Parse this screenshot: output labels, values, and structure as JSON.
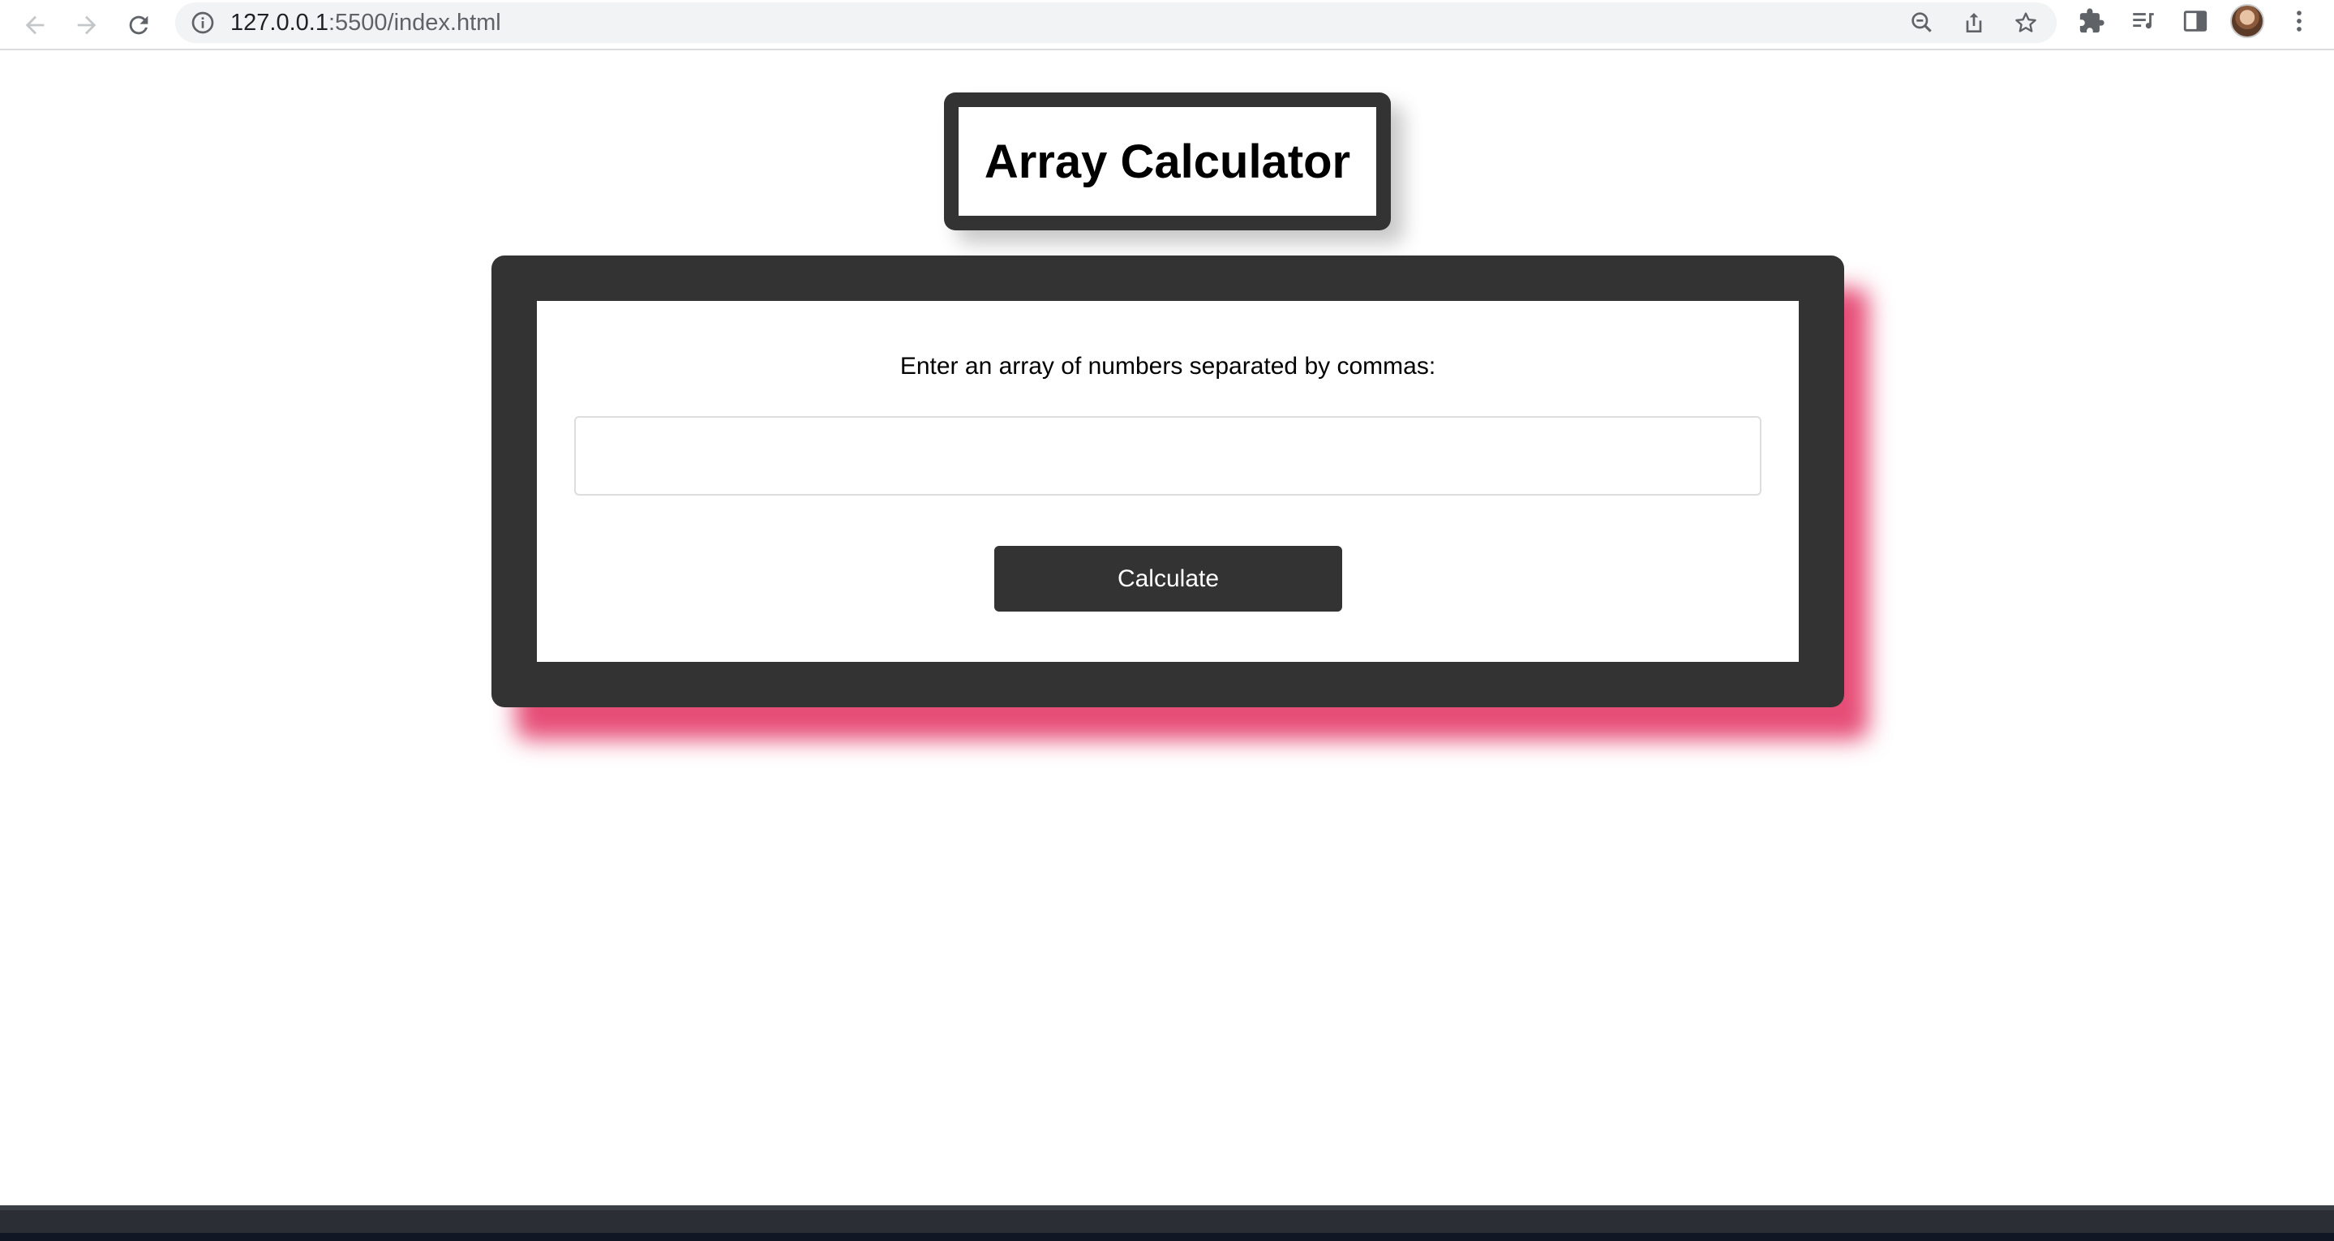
{
  "browser": {
    "url_host": "127.0.0.1",
    "url_rest": ":5500/index.html",
    "icons": {
      "back": "arrow-left-icon",
      "forward": "arrow-right-icon",
      "reload": "reload-icon",
      "site_info": "info-icon",
      "zoom": "zoom-out-icon",
      "share": "share-icon",
      "bookmark": "star-icon",
      "extensions": "puzzle-icon",
      "media": "playlist-icon",
      "side_panel": "side-panel-icon",
      "menu": "kebab-menu-icon"
    }
  },
  "page": {
    "title": "Array Calculator",
    "prompt": "Enter an array of numbers separated by commas:",
    "input_value": "",
    "button_label": "Calculate"
  },
  "colors": {
    "dark": "#333333",
    "shadow_accent": "#e23464",
    "background": "#ffffff"
  }
}
